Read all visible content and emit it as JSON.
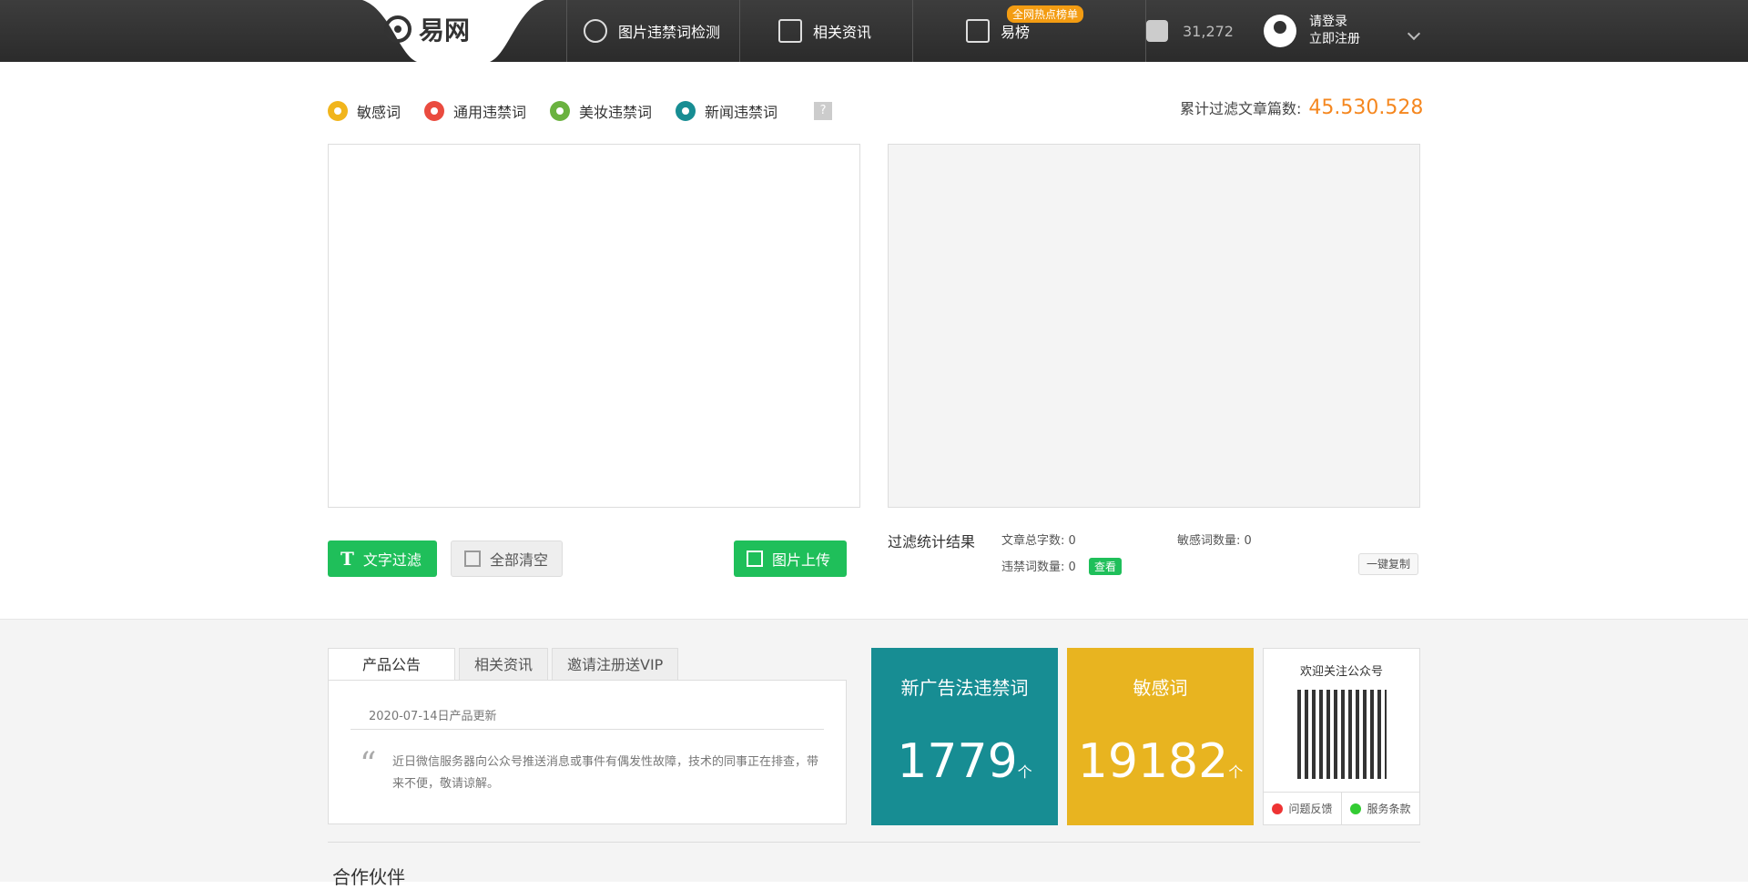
{
  "header": {
    "logo_text": "易网",
    "nav": [
      {
        "label": "图片违禁词检测",
        "icon": "image-check-icon"
      },
      {
        "label": "相关资讯",
        "icon": "news-icon"
      },
      {
        "label": "易榜",
        "icon": "list-icon"
      }
    ],
    "hot_tag": "全网热点榜单",
    "likes": "31,272",
    "login": "请登录",
    "register": "立即注册"
  },
  "legend": {
    "items": [
      {
        "label": "敏感词",
        "color": "#f1b51c"
      },
      {
        "label": "通用违禁词",
        "color": "#ea4b3f"
      },
      {
        "label": "美妆违禁词",
        "color": "#6ab23f"
      },
      {
        "label": "新闻违禁词",
        "color": "#178d93"
      }
    ],
    "help": "?"
  },
  "counter": {
    "label": "累计过滤文章篇数:",
    "value": "45.530.528"
  },
  "buttons": {
    "text_filter": "文字过滤",
    "clear_all": "全部清空",
    "image_upload": "图片上传"
  },
  "stats": {
    "title": "过滤统计结果",
    "total_chars_label": "文章总字数:",
    "total_chars": "0",
    "sensitive_label": "敏感词数量:",
    "sensitive": "0",
    "banned_label": "违禁词数量:",
    "banned": "0",
    "view": "查看",
    "copy": "一键复制"
  },
  "tabs": [
    "产品公告",
    "相关资讯",
    "邀请注册送VIP"
  ],
  "notice": {
    "date": "2020-07-14日产品更新",
    "text": "近日微信服务器向公众号推送消息或事件有偶发性故障，技术的同事正在排查，带来不便，敬请谅解。"
  },
  "cards": [
    {
      "title": "新广告法违禁词",
      "value": "1779",
      "unit": "个",
      "color": "#178d93"
    },
    {
      "title": "敏感词",
      "value": "19182",
      "unit": "个",
      "color": "#e8b420"
    }
  ],
  "qr": {
    "title": "欢迎关注公众号",
    "feedback": "问题反馈",
    "terms": "服务条款"
  },
  "partners": {
    "title": "合作伙伴"
  }
}
